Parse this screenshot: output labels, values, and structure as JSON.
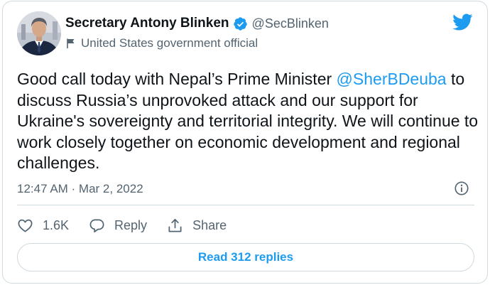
{
  "author": {
    "display_name": "Secretary Antony Blinken",
    "handle": "@SecBlinken",
    "label": "United States government official",
    "verified": true
  },
  "tweet": {
    "text_before_mention": "Good call today with Nepal’s Prime Minister ",
    "mention": "@SherBDeuba",
    "text_after_mention": " to discuss Russia’s unprovoked attack and our support for Ukraine's sovereignty and territorial integrity. We will continue to work closely together on economic development and regional challenges.",
    "timestamp": "12:47 AM · Mar 2, 2022"
  },
  "actions": {
    "like_count": "1.6K",
    "reply_label": "Reply",
    "share_label": "Share"
  },
  "read_replies_label": "Read 312 replies",
  "colors": {
    "accent": "#1d9bf0",
    "text_primary": "#0f1419",
    "text_secondary": "#536471",
    "border": "#cfd9de"
  },
  "icons": [
    "verified-badge-icon",
    "flag-icon",
    "twitter-logo-icon",
    "info-icon",
    "heart-icon",
    "reply-icon",
    "share-icon"
  ]
}
